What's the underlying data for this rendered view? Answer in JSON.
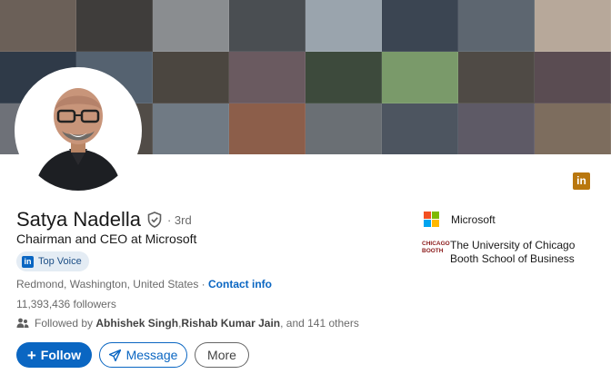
{
  "profile": {
    "name": "Satya Nadella",
    "degree": "· 3rd",
    "headline": "Chairman and CEO at Microsoft",
    "top_voice_label": "Top Voice",
    "location": "Redmond, Washington, United States",
    "location_separator": " · ",
    "contact_info_label": "Contact info",
    "followers": "11,393,436 followers",
    "followed_by": {
      "prefix": "Followed by ",
      "person1": "Abhishek Singh",
      "separator": ", ",
      "person2": "Rishab Kumar Jain",
      "suffix": ", and 141 others"
    }
  },
  "actions": {
    "follow_label": "Follow",
    "message_label": "Message",
    "more_label": "More"
  },
  "organizations": [
    {
      "name": "Microsoft",
      "icon": "microsoft-logo"
    },
    {
      "name": "The University of Chicago Booth School of Business",
      "icon": "chicago-booth-logo"
    }
  ],
  "logo_text": {
    "li_badge": "in",
    "top_voice_in": "in",
    "chicago": "CHICAGO",
    "booth": "BOOTH"
  },
  "colors": {
    "brand_blue": "#0a66c2",
    "badge_gold": "#b9770e",
    "top_voice_bg": "#e4ecf4"
  },
  "icons": [
    "verified-shield-icon",
    "linkedin-badge-icon",
    "people-icon",
    "plus-icon",
    "paper-plane-icon"
  ]
}
